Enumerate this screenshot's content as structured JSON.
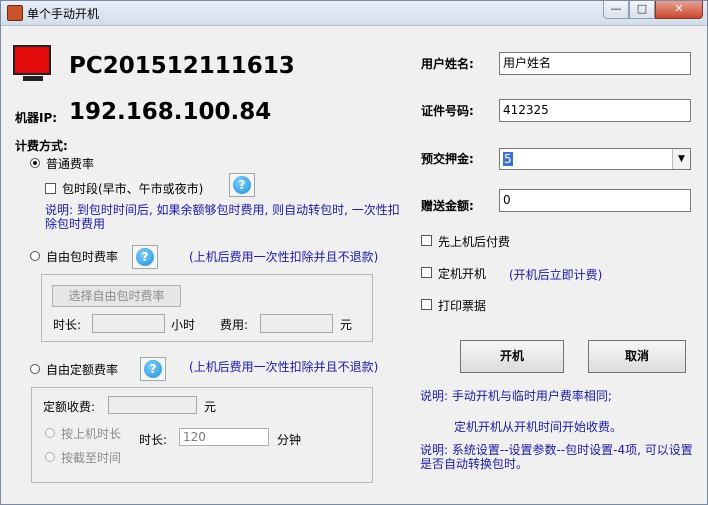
{
  "window": {
    "title": "单个手动开机",
    "minimize": "—",
    "maximize": "□",
    "close": "✕"
  },
  "pc": {
    "name": "PC201512111613",
    "ip_label": "机器IP:",
    "ip": "192.168.100.84"
  },
  "billing": {
    "section_label": "计费方式:",
    "normal": {
      "label": "普通费率",
      "period_label": "包时段(早市、午市或夜市)",
      "note": "说明: 到包时时间后, 如果余额够包时费用, 则自动转包时, 一次性扣除包时费用"
    },
    "free_period": {
      "label": "自由包时费率",
      "note": "(上机后费用一次性扣除并且不退款)",
      "select_button": "选择自由包时费率",
      "duration_label": "时长:",
      "hour_unit": "小时",
      "fee_label": "费用:",
      "yuan": "元"
    },
    "fixed": {
      "label": "自由定额费率",
      "note": "(上机后费用一次性扣除并且不退款)",
      "amount_label": "定额收费:",
      "yuan": "元",
      "by_duration": "按上机时长",
      "duration_label": "时长:",
      "duration_value": "120",
      "minute_unit": "分钟",
      "by_deadline": "按截至时间"
    }
  },
  "user": {
    "name_label": "用户姓名:",
    "name_value": "用户姓名",
    "id_label": "证件号码:",
    "id_value": "412325",
    "deposit_label": "预交押金:",
    "deposit_value": "5",
    "gift_label": "赠送金额:",
    "gift_value": "0"
  },
  "options": {
    "pay_later": "先上机后付费",
    "timed_start": "定机开机",
    "timed_note": "(开机后立即计费)",
    "print_ticket": "打印票据"
  },
  "buttons": {
    "start": "开机",
    "cancel": "取消"
  },
  "notes": {
    "line1": "说明: 手动开机与临时用户费率相同;",
    "line2": "定机开机从开机时间开始收费。",
    "line3": "说明: 系统设置--设置参数--包时设置-4项, 可以设置是否自动转换包时。"
  },
  "icons": {
    "help": "?"
  },
  "colors": {
    "accent_blue": "#1a1aa8",
    "pc_red": "#e30b0b"
  }
}
